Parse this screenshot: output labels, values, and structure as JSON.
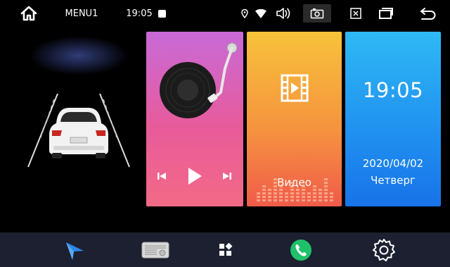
{
  "status_bar": {
    "menu_label": "MENU1",
    "time": "19:05"
  },
  "tiles": {
    "video": {
      "label": "Видео"
    },
    "clock": {
      "time": "19:05",
      "date": "2020/04/02",
      "weekday": "Четверг"
    }
  },
  "dock": {
    "items": [
      "navigation-icon",
      "radio-icon",
      "apps-icon",
      "phone-icon",
      "settings-icon"
    ]
  },
  "colors": {
    "music_gradient": [
      "#c86ad8",
      "#f36a86"
    ],
    "video_gradient": [
      "#f7c23a",
      "#f05b4a"
    ],
    "clock_gradient": [
      "#2fb9f4",
      "#1873e8"
    ],
    "dock_background": "#1d2030",
    "phone_green": "#1fc16b",
    "nav_blue": "#2a86e8"
  }
}
